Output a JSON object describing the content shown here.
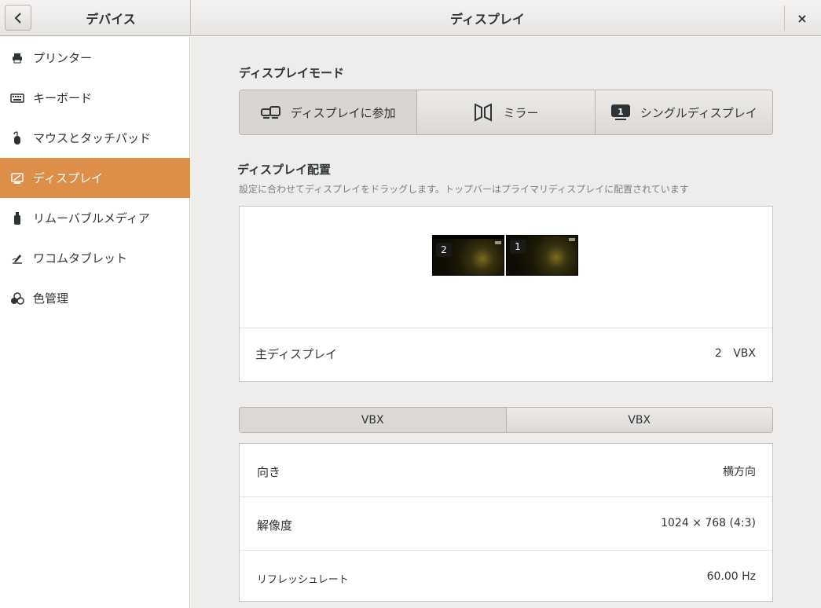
{
  "header": {
    "sidebar_title": "デバイス",
    "page_title": "ディスプレイ",
    "close_glyph": "×"
  },
  "sidebar": {
    "items": [
      {
        "label": "プリンター",
        "icon": "printer-icon"
      },
      {
        "label": "キーボード",
        "icon": "keyboard-icon"
      },
      {
        "label": "マウスとタッチパッド",
        "icon": "mouse-icon"
      },
      {
        "label": "ディスプレイ",
        "icon": "display-icon",
        "active": true
      },
      {
        "label": "リムーバブルメディア",
        "icon": "usb-drive-icon"
      },
      {
        "label": "ワコムタブレット",
        "icon": "tablet-pen-icon"
      },
      {
        "label": "色管理",
        "icon": "color-circles-icon"
      }
    ]
  },
  "display_mode": {
    "title": "ディスプレイモード",
    "options": [
      {
        "label": "ディスプレイに参加",
        "icon": "join-displays-icon",
        "selected": true
      },
      {
        "label": "ミラー",
        "icon": "mirror-icon",
        "selected": false
      },
      {
        "label": "シングルディスプレイ",
        "icon": "single-display-icon",
        "selected": false
      }
    ]
  },
  "arrangement": {
    "title": "ディスプレイ配置",
    "subtitle": "設定に合わせてディスプレイをドラッグします。トップバーはプライマリディスプレイに配置されています",
    "monitors": [
      {
        "number": "2"
      },
      {
        "number": "1"
      }
    ],
    "primary_label": "主ディスプレイ",
    "primary_value": "2 VBX"
  },
  "tabs": [
    "VBX",
    "VBX"
  ],
  "settings": {
    "orientation_label": "向き",
    "orientation_value": "横方向",
    "resolution_label": "解像度",
    "resolution_value": "1024 × 768 (4:3)",
    "refresh_label": "リフレッシュレート",
    "refresh_value": "60.00 Hz"
  },
  "colors": {
    "accent": "#dd8f4a",
    "sidebar_bg": "#ffffff",
    "content_bg": "#efedeb"
  }
}
